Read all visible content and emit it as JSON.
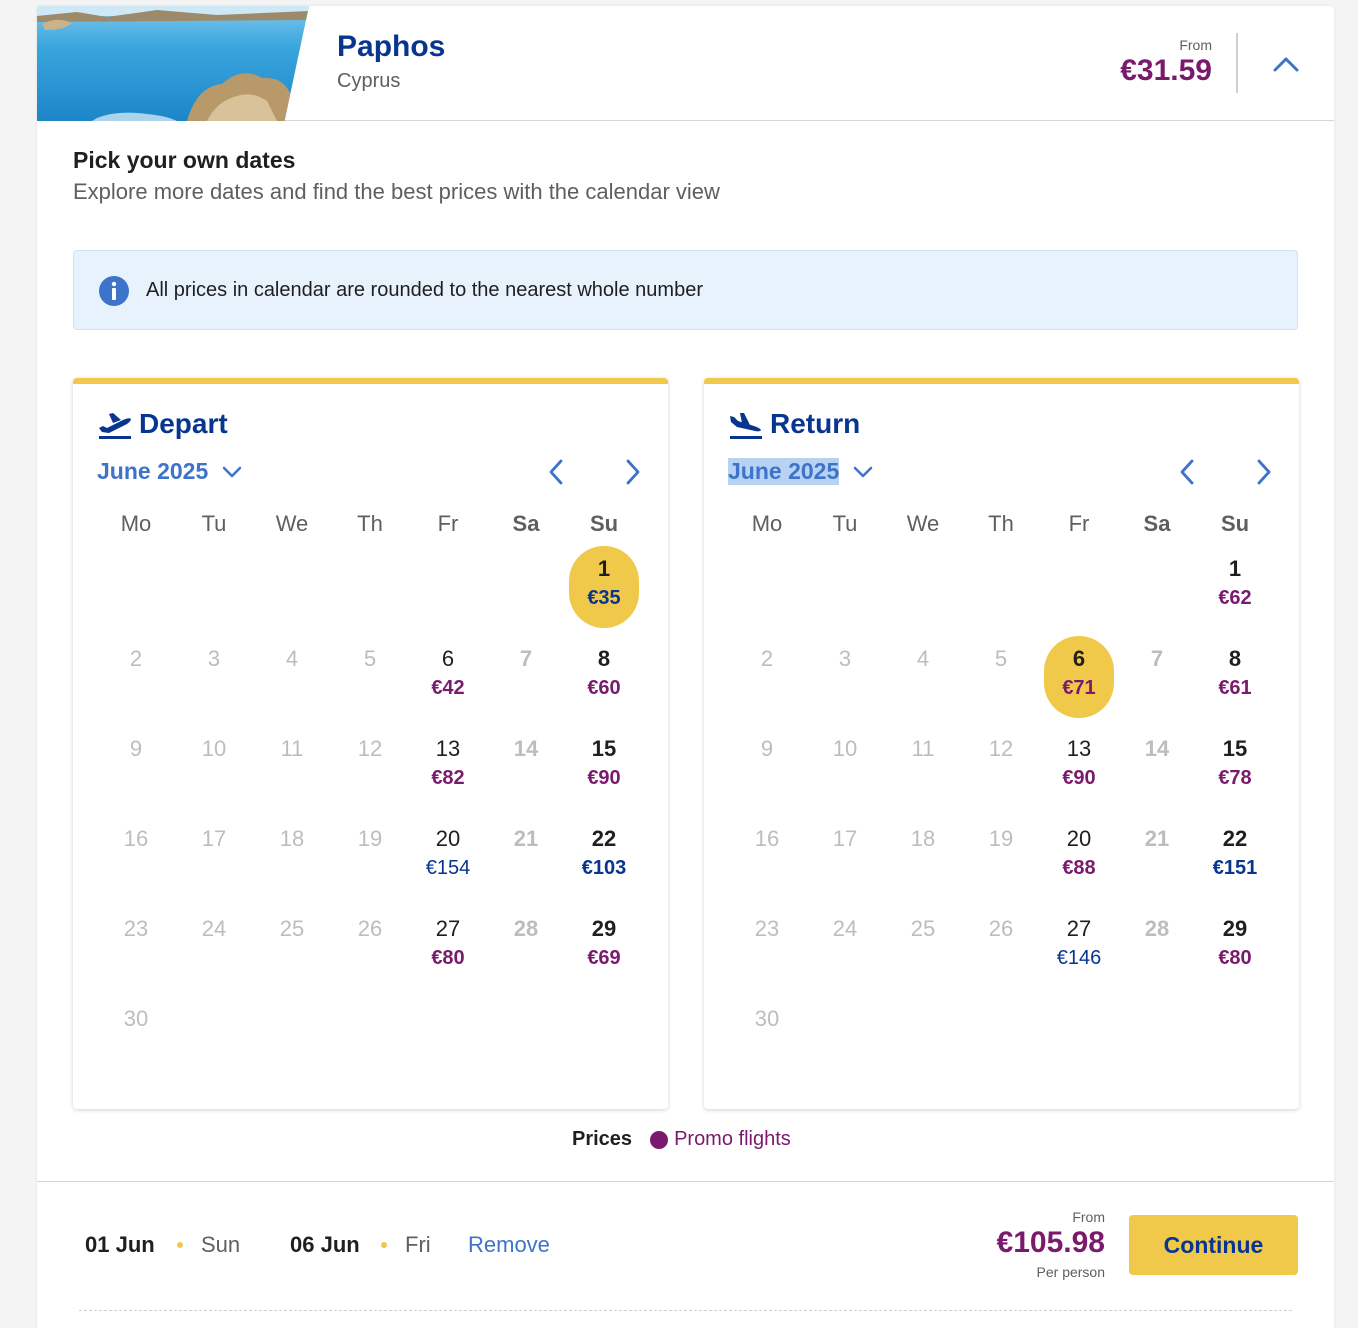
{
  "destination": {
    "city": "Paphos",
    "country": "Cyprus",
    "from_label": "From",
    "from_price": "€31.59"
  },
  "intro": {
    "title": "Pick your own dates",
    "subtitle": "Explore more dates and find the best prices with the calendar view"
  },
  "info": {
    "text": "All prices in calendar are rounded to the nearest whole number"
  },
  "weekdays": [
    "Mo",
    "Tu",
    "We",
    "Th",
    "Fr",
    "Sa",
    "Su"
  ],
  "depart": {
    "title": "Depart",
    "month": "June 2025",
    "selected": 1,
    "days": {
      "1": {
        "price": "€35",
        "promo": true
      },
      "6": {
        "price": "€42",
        "promo": true
      },
      "8": {
        "price": "€60",
        "promo": true
      },
      "13": {
        "price": "€82",
        "promo": true
      },
      "15": {
        "price": "€90",
        "promo": true
      },
      "20": {
        "price": "€154",
        "promo": false
      },
      "22": {
        "price": "€103",
        "promo": false
      },
      "27": {
        "price": "€80",
        "promo": true
      },
      "29": {
        "price": "€69",
        "promo": true
      }
    }
  },
  "return": {
    "title": "Return",
    "month": "June 2025",
    "selected": 6,
    "days": {
      "1": {
        "price": "€62",
        "promo": true
      },
      "6": {
        "price": "€71",
        "promo": true
      },
      "8": {
        "price": "€61",
        "promo": true
      },
      "13": {
        "price": "€90",
        "promo": true
      },
      "15": {
        "price": "€78",
        "promo": true
      },
      "20": {
        "price": "€88",
        "promo": true
      },
      "22": {
        "price": "€151",
        "promo": false
      },
      "27": {
        "price": "€146",
        "promo": false
      },
      "29": {
        "price": "€80",
        "promo": true
      }
    }
  },
  "legend": {
    "label": "Prices",
    "promo": "Promo flights"
  },
  "summary": {
    "depart_date": "01 Jun",
    "depart_day": "Sun",
    "return_date": "06 Jun",
    "return_day": "Fri",
    "remove": "Remove",
    "from_label": "From",
    "total": "€105.98",
    "per_person": "Per person",
    "continue": "Continue"
  },
  "colors": {
    "brand_blue": "#073590",
    "link_blue": "#3d74c9",
    "promo_purple": "#7a1a6c",
    "accent_yellow": "#f0c94b",
    "info_bg": "#e7f2fc"
  },
  "icons": {
    "collapse": "chevron-up-icon",
    "info": "info-icon",
    "depart": "plane-takeoff-icon",
    "return": "plane-landing-icon",
    "month_dropdown": "chevron-down-icon",
    "prev": "chevron-left-icon",
    "next": "chevron-right-icon"
  }
}
